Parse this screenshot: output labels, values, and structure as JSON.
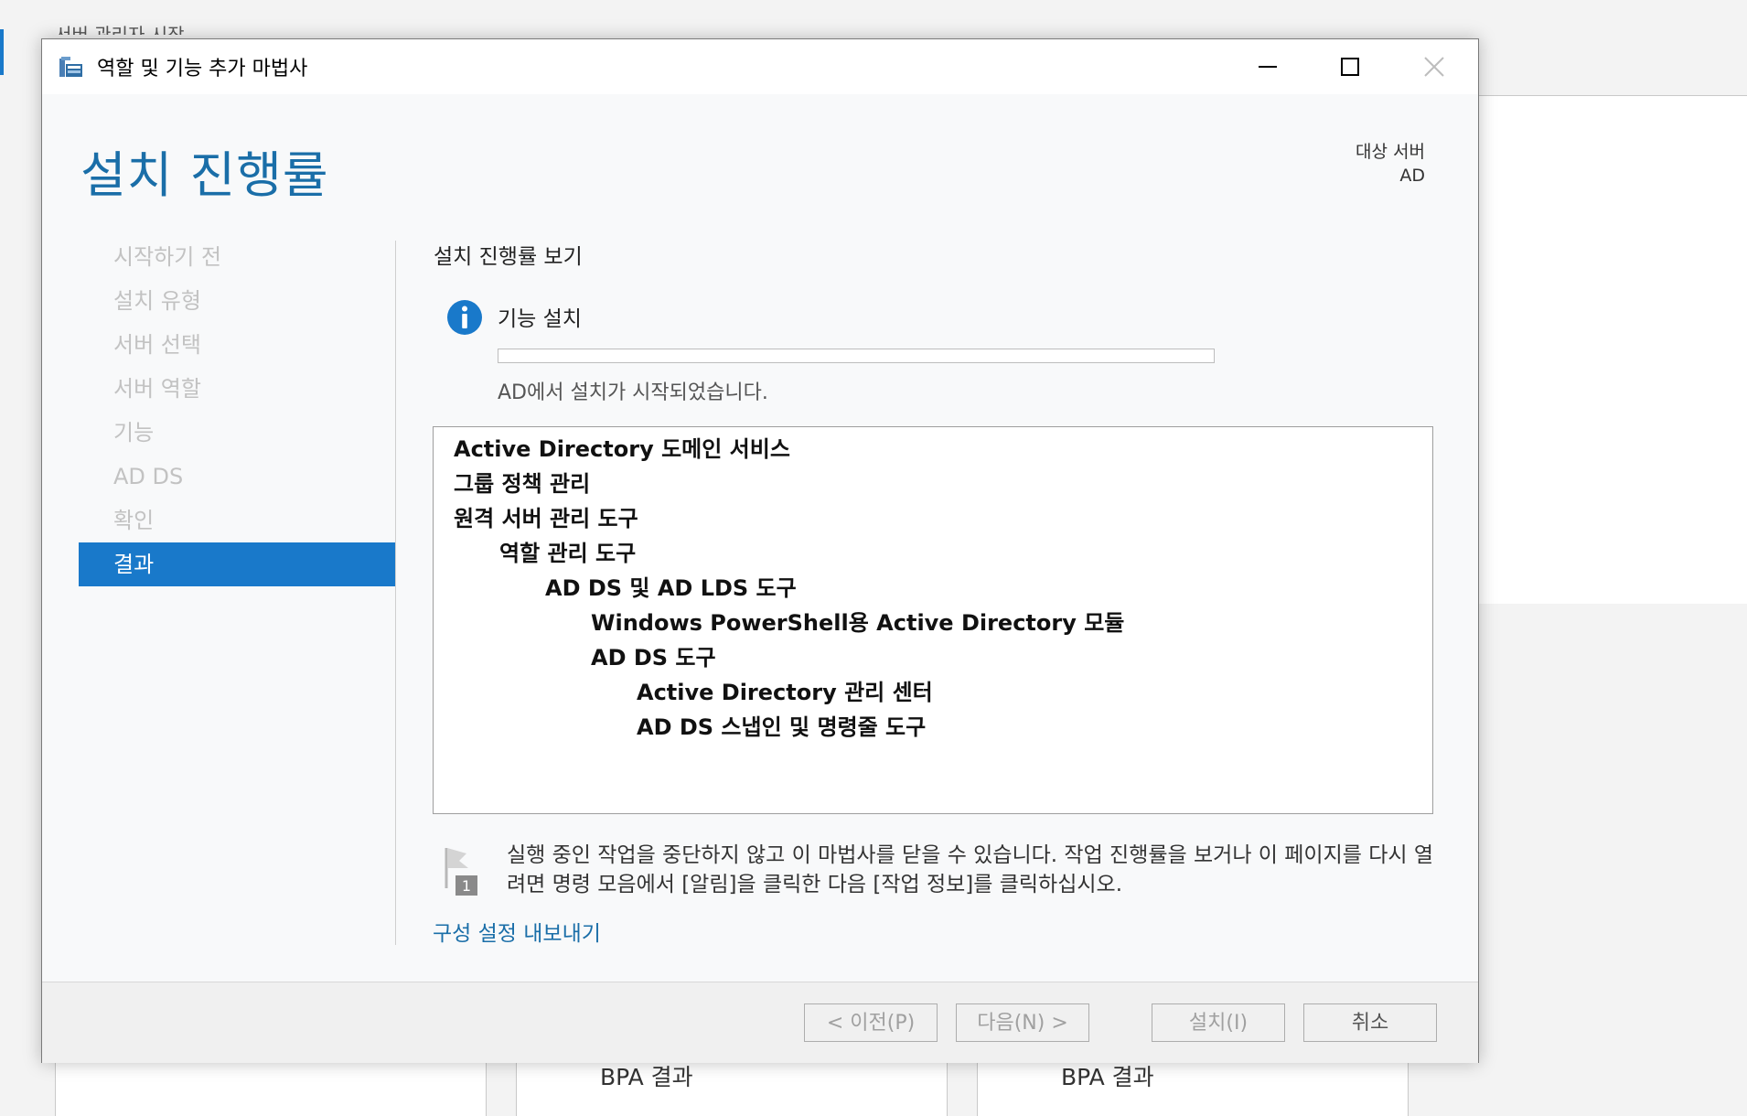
{
  "background": {
    "title": "서버 관리자 시작",
    "tiles": [
      {
        "label": "BPA 결과"
      },
      {
        "label": "BPA 결과"
      }
    ]
  },
  "window": {
    "title": "역할 및 기능 추가 마법사",
    "minimize_icon": "minimize-icon",
    "maximize_icon": "maximize-icon",
    "close_icon": "close-icon"
  },
  "header": {
    "page_title": "설치 진행률",
    "target_label": "대상 서버",
    "target_value": "AD"
  },
  "nav": {
    "items": [
      {
        "label": "시작하기 전",
        "active": false
      },
      {
        "label": "설치 유형",
        "active": false
      },
      {
        "label": "서버 선택",
        "active": false
      },
      {
        "label": "서버 역할",
        "active": false
      },
      {
        "label": "기능",
        "active": false
      },
      {
        "label": "AD DS",
        "active": false
      },
      {
        "label": "확인",
        "active": false
      },
      {
        "label": "결과",
        "active": true
      }
    ]
  },
  "content": {
    "section_title": "설치 진행률 보기",
    "feature_label": "기능 설치",
    "progress_fraction": 0.0,
    "status": "AD에서 설치가 시작되었습니다.",
    "features": [
      {
        "label": "Active Directory 도메인 서비스",
        "level": 0
      },
      {
        "label": "그룹 정책 관리",
        "level": 0
      },
      {
        "label": "원격 서버 관리 도구",
        "level": 0
      },
      {
        "label": "역할 관리 도구",
        "level": 1
      },
      {
        "label": "AD DS 및 AD LDS 도구",
        "level": 2
      },
      {
        "label": "Windows PowerShell용 Active Directory 모듈",
        "level": 3
      },
      {
        "label": "AD DS 도구",
        "level": 3
      },
      {
        "label": "Active Directory 관리 센터",
        "level": 4
      },
      {
        "label": "AD DS 스냅인 및 명령줄 도구",
        "level": 4
      }
    ],
    "note": "실행 중인 작업을 중단하지 않고 이 마법사를 닫을 수 있습니다. 작업 진행률을 보거나 이 페이지를 다시 열려면 명령 모음에서 [알림]을 클릭한 다음 [작업 정보]를 클릭하십시오.",
    "note_badge": "1",
    "export_link": "구성 설정 내보내기"
  },
  "footer": {
    "prev_label": "< 이전(P)",
    "next_label": "다음(N) >",
    "install_label": "설치(I)",
    "cancel_label": "취소"
  },
  "colors": {
    "accent": "#1979ca",
    "heading": "#1a6ea8",
    "info_icon": "#1979ca"
  }
}
